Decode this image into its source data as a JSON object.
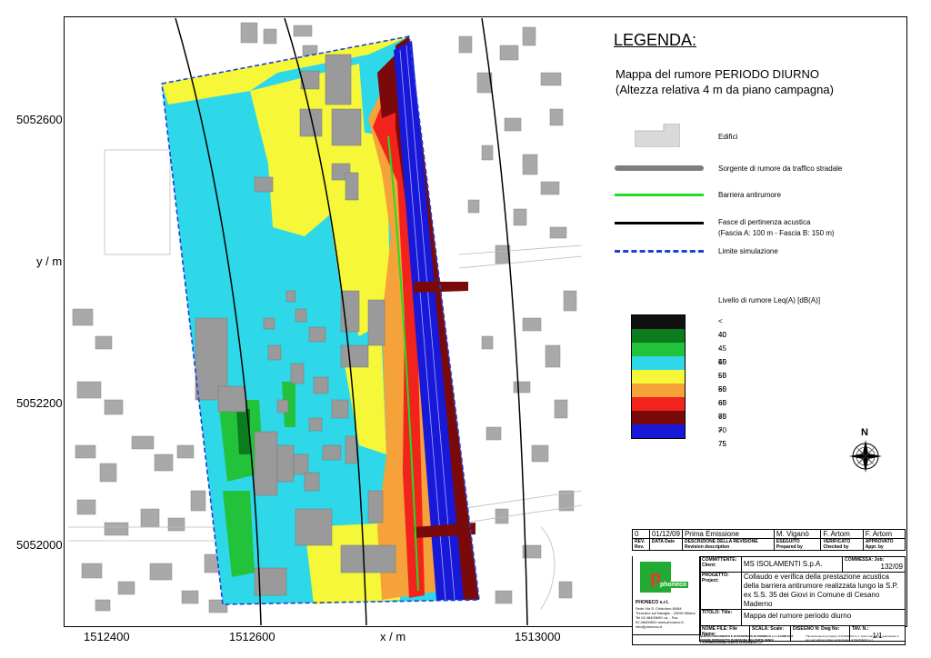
{
  "map": {
    "y_ticks": [
      "5052600",
      "5052200",
      "5052000"
    ],
    "x_ticks": [
      "1512400",
      "1512600",
      "1513000"
    ],
    "y_axis_label": "y / m",
    "x_axis_label": "x / m",
    "colors": {
      "lt40": "#111111",
      "c40_45": "#0b7d1e",
      "c45_50": "#23c23b",
      "c50_55": "#2ed8e8",
      "c55_60": "#f7f73a",
      "c60_65": "#f5a23a",
      "c65_70": "#f2231c",
      "c70_75": "#7a0a0a",
      "gt75": "#1818d8",
      "building": "#9e9e9e",
      "boundary": "#1f3fd8",
      "barrier": "#22dd22"
    }
  },
  "legend": {
    "title": "LEGENDA:",
    "subtitle_line1": "Mappa del rumore PERIODO DIURNO",
    "subtitle_line2": "(Altezza relativa 4 m da piano campagna)",
    "items": [
      {
        "label": "Edifici",
        "icon": "building-icon"
      },
      {
        "label": "Sorgente di rumore da traffico stradale",
        "icon": "road-source-line"
      },
      {
        "label": "Barriera antirumore",
        "icon": "barrier-line"
      },
      {
        "label": "Fasce di pertinenza acustica",
        "label2": "(Fascia A: 100 m - Fascia B: 150 m)",
        "icon": "belt-line"
      },
      {
        "label": "Limite simulazione",
        "icon": "simulation-limit-line"
      }
    ],
    "scale_title": "Livello di rumore Leq(A) [dB(A)]",
    "scale": [
      {
        "label": "< 40",
        "color": "#111111"
      },
      {
        "label": "40 - 45",
        "color": "#0b7d1e"
      },
      {
        "label": "45 - 50",
        "color": "#23c23b"
      },
      {
        "label": "50 - 55",
        "color": "#2ed8e8"
      },
      {
        "label": "55 - 60",
        "color": "#f7f73a"
      },
      {
        "label": "60 - 65",
        "color": "#f5a23a"
      },
      {
        "label": "65 - 70",
        "color": "#f2231c"
      },
      {
        "label": "70 - 75",
        "color": "#7a0a0a"
      },
      {
        "label": "> 75",
        "color": "#1818d8"
      }
    ],
    "north_label": "N"
  },
  "title_block": {
    "rev_num": "0",
    "rev_date": "01/12/09",
    "rev_desc": "Prima Emissione",
    "prepared": "M. Viganò",
    "checked": "F. Artom",
    "approved": "F. Artom",
    "cap_rev": "REV. Rev.",
    "cap_data": "DATA Date",
    "cap_descr": "DESCRIZIONE DELLA REVISIONE Revision description",
    "cap_eseguito": "ESEGUITO Prepared by",
    "cap_verificato": "VERIFICATO Checked by",
    "cap_approvato": "APPROVATO Appr. by",
    "cap_committente": "COMMITTENTE: Client:",
    "client": "MS ISOLAMENTI S.p.A.",
    "cap_commessa": "COMMESSA: Job:",
    "job": "132/09",
    "cap_progetto": "PROGETTO: Project:",
    "project": "Collaudo e verifica della prestazione acustica della barriera antirumore realizzata lungo la S.P. ex S.S. 35 dei Giovi in Comune di Cesano Maderno",
    "cap_titolo": "TITOLO: Title:",
    "title": "Mappa del rumore periodo diurno",
    "cap_nomefile": "NOME FILE: File Name:",
    "cap_scala": "SCALA: Scale:",
    "cap_disegno": "DISEGNO N: Dwg No:",
    "cap_tav": "TAV. N.:",
    "sheet": "1/1",
    "company_logo": "phoneco",
    "company_name": "PHONECO s.r.l.",
    "company_addr": "Sede Via S. Cristoforo 80/84 Trezzano sul Naviglio - 20090 Milano Tel 02.48403690 r.a. - Fax 02.48400691 www.phoneco.it - info@phoneco.it",
    "footer_it": "QUESTO DOCUMENTO È DI PROPRIETÀ DI PHONECO s.r.l. E NON PUÒ ESSERE RIPRODOTTO IN NESSUNA SUA PARTE SENZA L'AUTORIZZAZIONE SCRITTA DI PHONECO s.r.l.",
    "footer_en": "This document is property of PHONECO s.r.l. and it can not be reproduced in any part without written authorization of PHONECO s.r.l."
  }
}
